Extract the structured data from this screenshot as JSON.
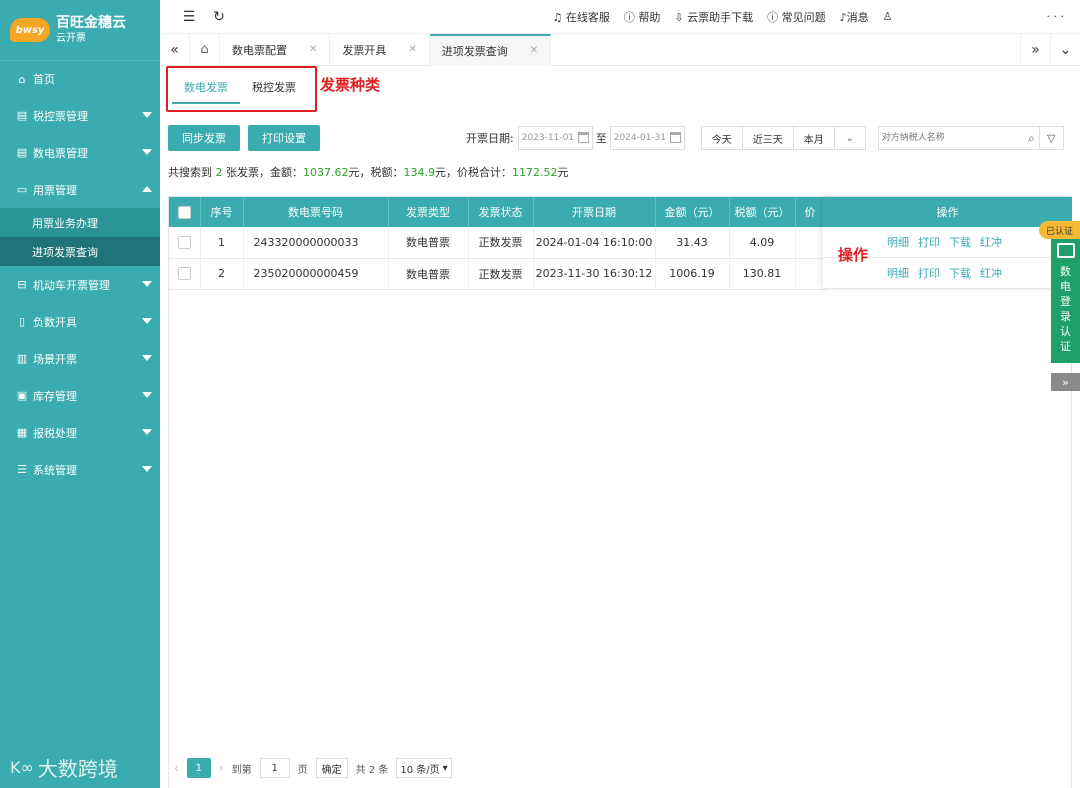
{
  "brand": {
    "badge": "bwsy",
    "title": "百旺金穗云",
    "subtitle": "云开票"
  },
  "sidebar": {
    "items": [
      {
        "label": "首页",
        "icon": "home-icon"
      },
      {
        "label": "税控票管理",
        "icon": "invoice-icon"
      },
      {
        "label": "数电票管理",
        "icon": "invoice-icon"
      },
      {
        "label": "用票管理",
        "icon": "ticket-icon"
      },
      {
        "label": "机动车开票管理",
        "icon": "car-icon"
      },
      {
        "label": "负数开具",
        "icon": "doc-icon"
      },
      {
        "label": "场景开票",
        "icon": "scene-icon"
      },
      {
        "label": "库存管理",
        "icon": "box-icon"
      },
      {
        "label": "报税处理",
        "icon": "chart-icon"
      },
      {
        "label": "系统管理",
        "icon": "settings-icon"
      }
    ],
    "subitems": [
      {
        "label": "用票业务办理"
      },
      {
        "label": "进项发票查询"
      }
    ]
  },
  "watermark": "大数跨境",
  "topbar": {
    "links": [
      "在线客服",
      "帮助",
      "云票助手下载",
      "常见问题",
      "消息"
    ],
    "more": "· · ·"
  },
  "tabs": [
    {
      "label": "数电票配置"
    },
    {
      "label": "发票开具"
    },
    {
      "label": "进项发票查询"
    }
  ],
  "subtabs": [
    "数电发票",
    "税控发票"
  ],
  "annotations": {
    "kind": "发票种类",
    "operation": "操作"
  },
  "buttons": {
    "sync": "同步发票",
    "print_settings": "打印设置"
  },
  "filters": {
    "date_label": "开票日期:",
    "start": "2023-11-01",
    "to": "至",
    "end": "2024-01-31",
    "ranges": [
      "今天",
      "近三天",
      "本月"
    ],
    "search_placeholder": "对方纳税人名称"
  },
  "summary": {
    "prefix": "共搜索到 ",
    "count": "2",
    "mid1": " 张发票，金额：",
    "amount": "1037.62",
    "mid2": "元，税额：",
    "tax": "134.9",
    "mid3": "元，价税合计：",
    "total": "1172.52",
    "suffix": "元"
  },
  "table": {
    "headers": [
      "序号",
      "数电票号码",
      "发票类型",
      "发票状态",
      "开票日期",
      "金额（元）",
      "税额（元）",
      "价"
    ],
    "ops_header": "操作",
    "rows": [
      [
        "1",
        "243320000000033",
        "数电普票",
        "正数发票",
        "2024-01-04 16:10:00",
        "31.43",
        "4.09",
        ""
      ],
      [
        "2",
        "235020000000459",
        "数电普票",
        "正数发票",
        "2023-11-30 16:30:12",
        "1006.19",
        "130.81",
        ""
      ]
    ],
    "ops": [
      "明细",
      "打印",
      "下载",
      "红冲"
    ]
  },
  "pager": {
    "current": "1",
    "goto_label": "到第",
    "goto_value": "1",
    "page_unit": "页",
    "confirm": "确定",
    "total": "共 2 条",
    "page_size": "10 条/页"
  },
  "auth_widget": {
    "badge": "已认证",
    "text": "数电登录认证"
  }
}
